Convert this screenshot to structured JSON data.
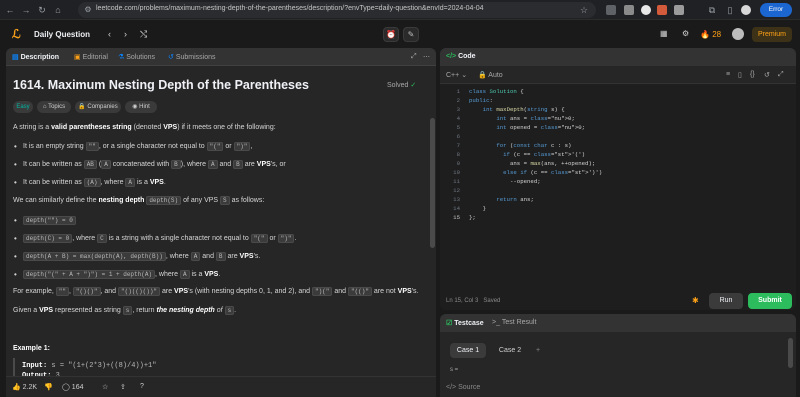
{
  "browser": {
    "url": "leetcode.com/problems/maximum-nesting-depth-of-the-parentheses/description/?envType=daily-question&envId=2024-04-04",
    "error_label": "Error"
  },
  "nav": {
    "title": "Daily Question",
    "streak": "28",
    "premium": "Premium"
  },
  "left_tabs": {
    "description": "Description",
    "editorial": "Editorial",
    "solutions": "Solutions",
    "submissions": "Submissions"
  },
  "problem": {
    "title": "1614. Maximum Nesting Depth of the Parentheses",
    "status": "Solved",
    "chips": {
      "difficulty": "Easy",
      "topics": "Topics",
      "companies": "Companies",
      "hint": "Hint"
    },
    "p1a": "A string is a ",
    "p1b": "valid parentheses string",
    "p1c": " (denoted ",
    "p1d": "VPS",
    "p1e": ") if it meets one of the following:",
    "b1a": "It is an empty string ",
    "b1code1": "\"\"",
    "b1b": ", or a single character not equal to ",
    "b1code2": "\"(\"",
    "b1c": " or ",
    "b1code3": "\")\"",
    "b1d": ",",
    "b2a": "It can be written as ",
    "b2code1": "AB",
    "b2b": " (",
    "b2code2": "A",
    "b2c": " concatenated with ",
    "b2code3": "B",
    "b2d": "), where ",
    "b2code4": "A",
    "b2e": " and ",
    "b2code5": "B",
    "b2f": " are ",
    "b2g": "VPS",
    "b2h": "'s, or",
    "b3a": "It can be written as ",
    "b3code1": "(A)",
    "b3b": ", where ",
    "b3code2": "A",
    "b3c": " is a ",
    "b3d": "VPS",
    "b3e": ".",
    "p2a": "We can similarly define the ",
    "p2b": "nesting depth",
    "p2code": "depth(S)",
    "p2c": " of any VPS ",
    "p2code2": "S",
    "p2d": " as follows:",
    "d1code": "depth(\"\") = 0",
    "d2code": "depth(C) = 0",
    "d2a": ", where ",
    "d2code2": "C",
    "d2b": " is a string with a single character not equal to ",
    "d2code3": "\"(\"",
    "d2c": " or ",
    "d2code4": "\")\"",
    "d2d": ".",
    "d3code": "depth(A + B) = max(depth(A), depth(B))",
    "d3a": ", where ",
    "d3code2": "A",
    "d3b": " and ",
    "d3code3": "B",
    "d3c": " are ",
    "d3d": "VPS",
    "d3e": "'s.",
    "d4code": "depth(\"(\" + A + \")\") = 1 + depth(A)",
    "d4a": ", where ",
    "d4code2": "A",
    "d4b": " is a ",
    "d4c": "VPS",
    "d4d": ".",
    "p3a": "For example, ",
    "p3code1": "\"\"",
    "p3b": ", ",
    "p3code2": "\"()()\"",
    "p3c": ", and ",
    "p3code3": "\"()(()())\"",
    "p3d": " are ",
    "p3e": "VPS",
    "p3f": "'s (with nesting depths 0, 1, and 2), and ",
    "p3code4": "\")(\"",
    "p3g": " and ",
    "p3code5": "\"(()\"",
    "p3h": " are not ",
    "p3i": "VPS",
    "p3j": "'s.",
    "p4a": "Given a ",
    "p4b": "VPS",
    "p4c": " represented as string ",
    "p4code": "s",
    "p4d": ", return ",
    "p4e": "the ",
    "p4f": "nesting depth",
    "p4g": " of ",
    "p4code2": "s",
    "p4h": ".",
    "example_title": "Example 1:",
    "input_label": "Input:",
    "input_value": "s = \"(1+(2*3)+((8)/4))+1\"",
    "output_label": "Output:",
    "output_value": "3"
  },
  "bottom": {
    "likes": "2.2K",
    "comments": "164"
  },
  "code": {
    "tab": "Code",
    "language": "C++",
    "mode": "Auto",
    "lines": [
      "class Solution {",
      "public:",
      "    int maxDepth(string s) {",
      "        int ans = 0;",
      "        int opened = 0;",
      "",
      "        for (const char c : s)",
      "          if (c == '(')",
      "            ans = max(ans, ++opened);",
      "          else if (c == ')')",
      "            --opened;",
      "",
      "        return ans;",
      "    }",
      "};"
    ],
    "status": "Ln 15, Col 3",
    "saved": "Saved",
    "run": "Run",
    "submit": "Submit"
  },
  "testcase": {
    "tab1": "Testcase",
    "tab2": "Test Result",
    "case1": "Case 1",
    "case2": "Case 2",
    "add": "+",
    "var_label": "s =",
    "source": "Source"
  }
}
